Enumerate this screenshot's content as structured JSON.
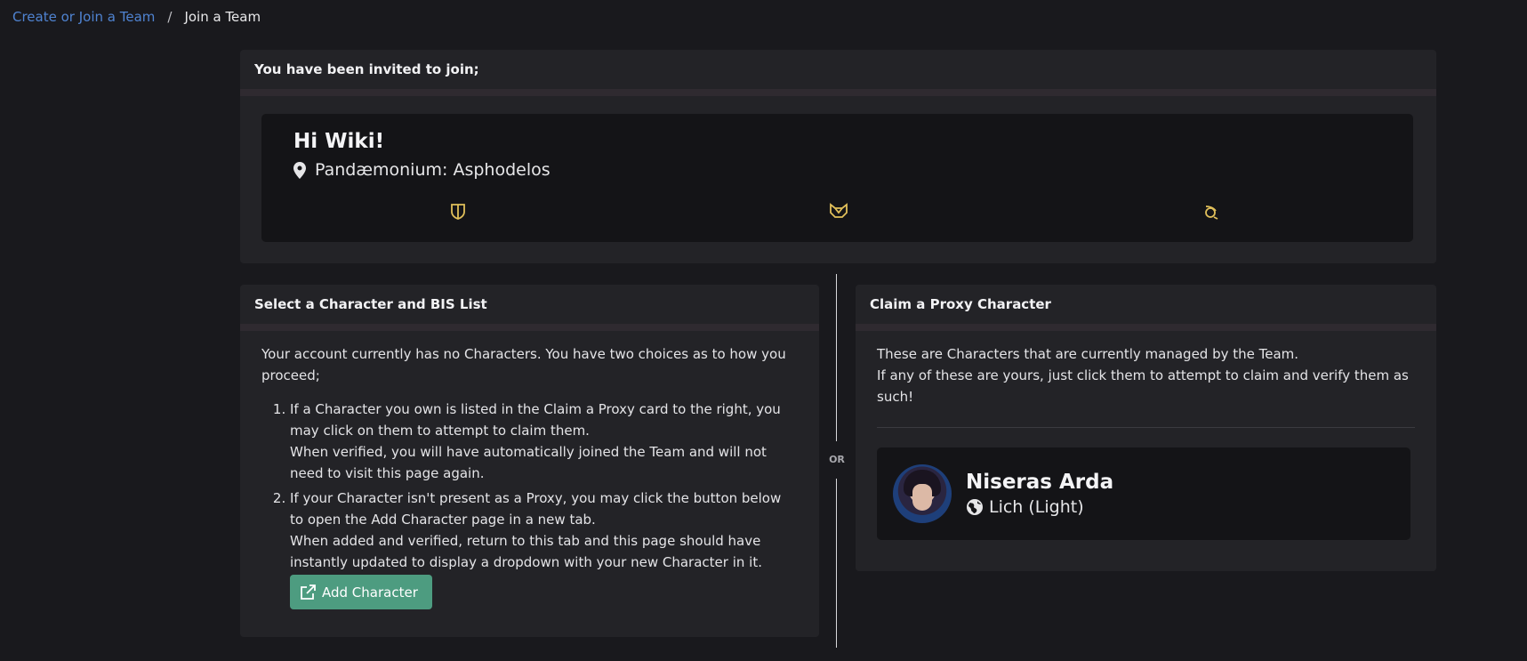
{
  "breadcrumb": {
    "parent": "Create or Join a Team",
    "separator": "/",
    "current": "Join a Team"
  },
  "invite": {
    "header": "You have been invited to join;",
    "greeting": "Hi Wiki!",
    "location_icon": "map-pin-icon",
    "location": "Pandæmonium: Asphodelos",
    "role_icons": [
      "tank-role-icon",
      "healer-role-icon",
      "dps-role-icon"
    ],
    "accent_color": "#e0bf5a"
  },
  "select_card": {
    "header": "Select a Character and BIS List",
    "intro": "Your account currently has no Characters. You have two choices as to how you proceed;",
    "steps": [
      {
        "line1": "If a Character you own is listed in the Claim a Proxy card to the right, you may click on them to attempt to claim them.",
        "line2": "When verified, you will have automatically joined the Team and will not need to visit this page again."
      },
      {
        "line1": "If your Character isn't present as a Proxy, you may click the button below to open the Add Character page in a new tab.",
        "line2": "When added and verified, return to this tab and this page should have instantly updated to display a dropdown with your new Character in it."
      }
    ],
    "add_button": "Add Character",
    "add_button_icon": "external-link-icon",
    "button_color": "#4d9c80"
  },
  "divider": {
    "label": "OR"
  },
  "proxy_card": {
    "header": "Claim a Proxy Character",
    "line1": "These are Characters that are currently managed by the Team.",
    "line2": "If any of these are yours, just click them to attempt to claim and verify them as such!",
    "character": {
      "name": "Niseras Arda",
      "world_icon": "globe-icon",
      "world": "Lich (Light)"
    }
  }
}
